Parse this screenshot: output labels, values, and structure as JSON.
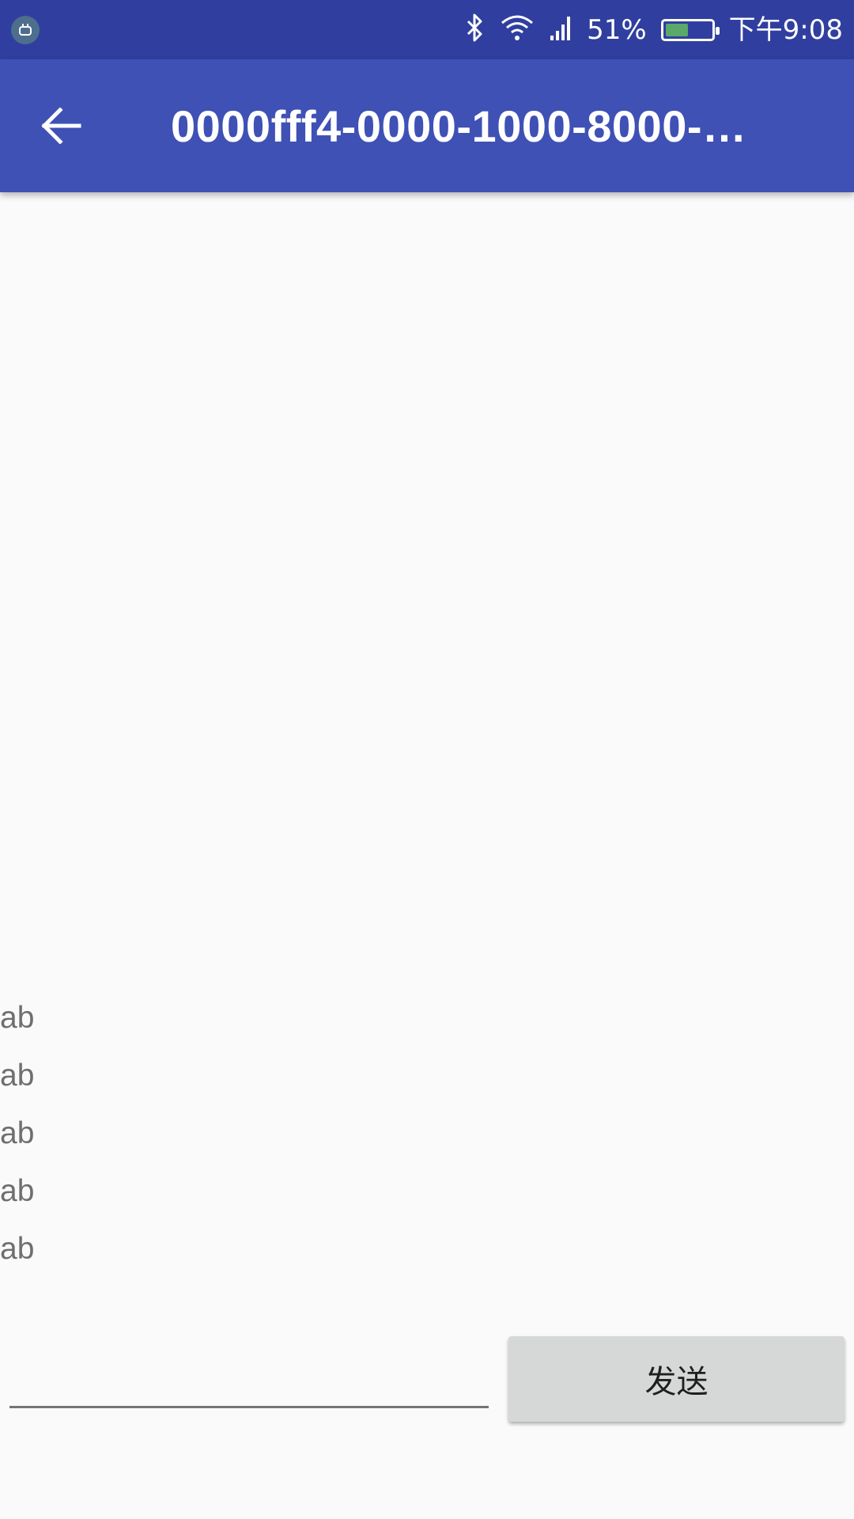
{
  "status_bar": {
    "notification_icon": "android-debug-icon",
    "bluetooth_icon": "bluetooth-icon",
    "wifi_icon": "wifi-icon",
    "signal_icon": "cell-signal-icon",
    "battery_percent_text": "51%",
    "battery_level": 0.51,
    "time": "下午9:08",
    "colors": {
      "background": "#303f9f",
      "battery_fill": "#5aa86a"
    }
  },
  "app_bar": {
    "back_icon": "arrow-back-icon",
    "title": "0000fff4-0000-1000-8000-…",
    "colors": {
      "background": "#3f51b5"
    }
  },
  "messages": [
    "ab",
    "ab",
    "ab",
    "ab",
    "ab"
  ],
  "composer": {
    "input_value": "",
    "send_label": "发送"
  }
}
